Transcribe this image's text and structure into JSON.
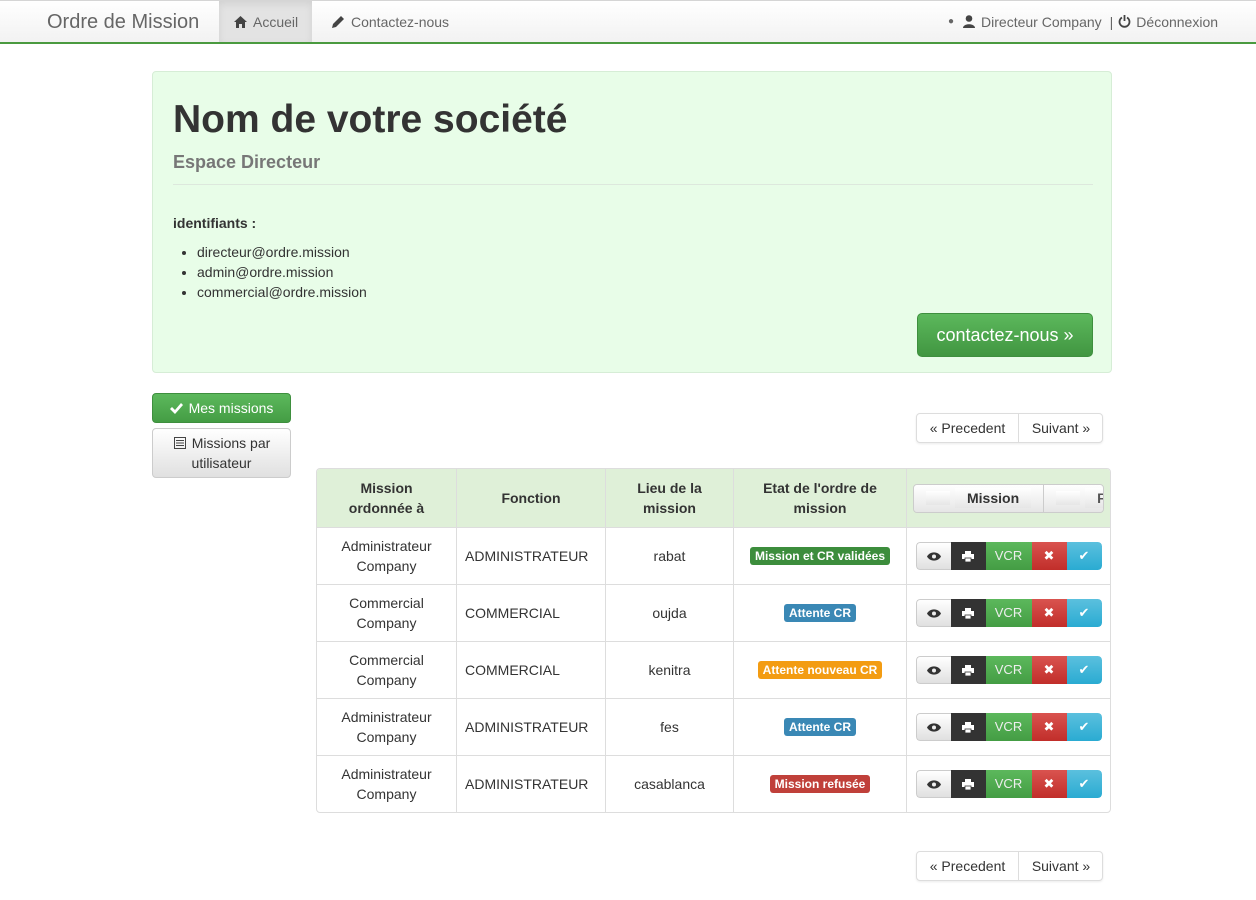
{
  "navbar": {
    "brand": "Ordre de Mission",
    "home": "Accueil",
    "contact": "Contactez-nous",
    "user": "Directeur Company",
    "separator": "|",
    "logout": "Déconnexion"
  },
  "jumbotron": {
    "title": "Nom de votre société",
    "subtitle": "Espace Directeur",
    "identifiants_label": "identifiants :",
    "identifiants": [
      "directeur@ordre.mission",
      "admin@ordre.mission",
      "commercial@ordre.mission"
    ],
    "contact_button": "contactez-nous »"
  },
  "sidebar": {
    "my_missions": "Mes missions",
    "missions_by_user_line1": "Missions par",
    "missions_by_user_line2": "utilisateur"
  },
  "pager": {
    "prev": "« Precedent",
    "next": "Suivant »"
  },
  "table": {
    "headers": {
      "ordered_to_1": "Mission",
      "ordered_to_2": "ordonnée à",
      "function": "Fonction",
      "place_1": "Lieu de la",
      "place_2": "mission",
      "state_1": "Etat de l'ordre de",
      "state_2": "mission",
      "add_mission": "Mission",
      "filter": "Filtrer"
    },
    "rows": [
      {
        "name_1": "Administrateur",
        "name_2": "Company",
        "function": "ADMINISTRATEUR",
        "place": "rabat",
        "state": "Mission et CR validées",
        "state_color": "#3c8d3c",
        "vcr": "VCR"
      },
      {
        "name_1": "Commercial",
        "name_2": "Company",
        "function": "COMMERCIAL",
        "place": "oujda",
        "state": "Attente CR",
        "state_color": "#3a88b5",
        "vcr": "VCR"
      },
      {
        "name_1": "Commercial",
        "name_2": "Company",
        "function": "COMMERCIAL",
        "place": "kenitra",
        "state": "Attente nouveau CR",
        "state_color": "#f39c12",
        "vcr": "VCR"
      },
      {
        "name_1": "Administrateur",
        "name_2": "Company",
        "function": "ADMINISTRATEUR",
        "place": "fes",
        "state": "Attente CR",
        "state_color": "#3a88b5",
        "vcr": "VCR"
      },
      {
        "name_1": "Administrateur",
        "name_2": "Company",
        "function": "ADMINISTRATEUR",
        "place": "casablanca",
        "state": "Mission refusée",
        "state_color": "#c0403a",
        "vcr": "VCR"
      }
    ]
  },
  "colors": {
    "accent": "#5cb85c",
    "jumbotron_bg": "#e8fde8",
    "header_bg": "#dff0d8"
  }
}
